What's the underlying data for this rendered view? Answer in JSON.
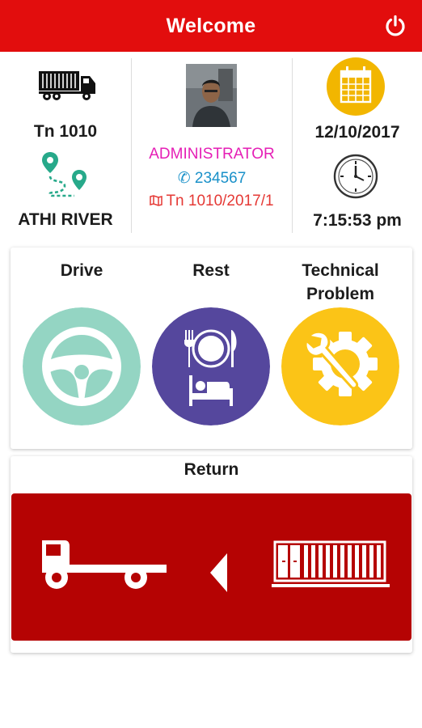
{
  "header": {
    "title": "Welcome",
    "power_icon": "power-icon",
    "color": "#e20d0d"
  },
  "vehicle": {
    "icon": "truck-icon",
    "number": "Tn 1010",
    "route_icon": "route-pin-icon",
    "location": "ATHI RIVER"
  },
  "driver": {
    "avatar": "driver-photo",
    "role": "ADMINISTRATOR",
    "phone": "234567",
    "trip": "Tn 1010/2017/1",
    "role_color": "#e51fb6",
    "phone_color": "#1a91c9",
    "trip_color": "#e53935"
  },
  "datetime": {
    "calendar_icon": "calendar-icon",
    "date": "12/10/2017",
    "clock_icon": "clock-icon",
    "time": "7:15:53 pm"
  },
  "actions": [
    {
      "label": "Drive",
      "icon": "steering-wheel-icon",
      "color": "#94d5c3"
    },
    {
      "label": "Rest",
      "icon": "dining-bed-icon",
      "color": "#55479d"
    },
    {
      "label": "Technical Problem",
      "icon": "wrench-gear-icon",
      "color": "#fbc417"
    }
  ],
  "return_section": {
    "label": "Return",
    "truck_icon": "flatbed-truck-icon",
    "arrow_icon": "left-arrow-icon",
    "container_icon": "container-icon",
    "color": "#b50303"
  }
}
